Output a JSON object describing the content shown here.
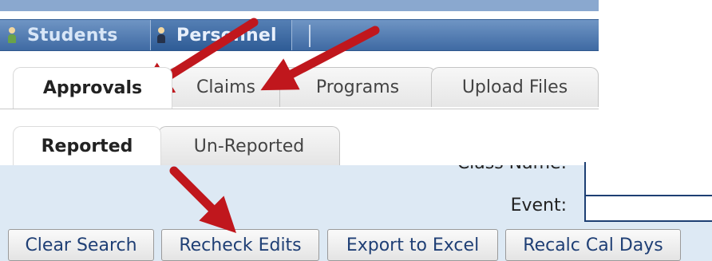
{
  "nav": {
    "students": "Students",
    "personnel": "Personnel"
  },
  "tabs": [
    {
      "label": "Approvals",
      "active": true
    },
    {
      "label": "Claims",
      "active": false
    },
    {
      "label": "Programs",
      "active": false
    },
    {
      "label": "Upload Files",
      "active": false
    }
  ],
  "subtabs": [
    {
      "label": "Reported",
      "active": true
    },
    {
      "label": "Un-Reported",
      "active": false
    }
  ],
  "form": {
    "class_name_label": "Class Name:",
    "class_name_value": "",
    "event_label": "Event:",
    "event_value": ""
  },
  "buttons": {
    "clear_search": "Clear Search",
    "recheck_edits": "Recheck Edits",
    "export_excel": "Export to Excel",
    "recalc_cal_days": "Recalc Cal Days"
  },
  "colors": {
    "annotation_arrow": "#c0171d",
    "nav_bar": "#4a74ab",
    "form_background": "#dde9f4"
  }
}
